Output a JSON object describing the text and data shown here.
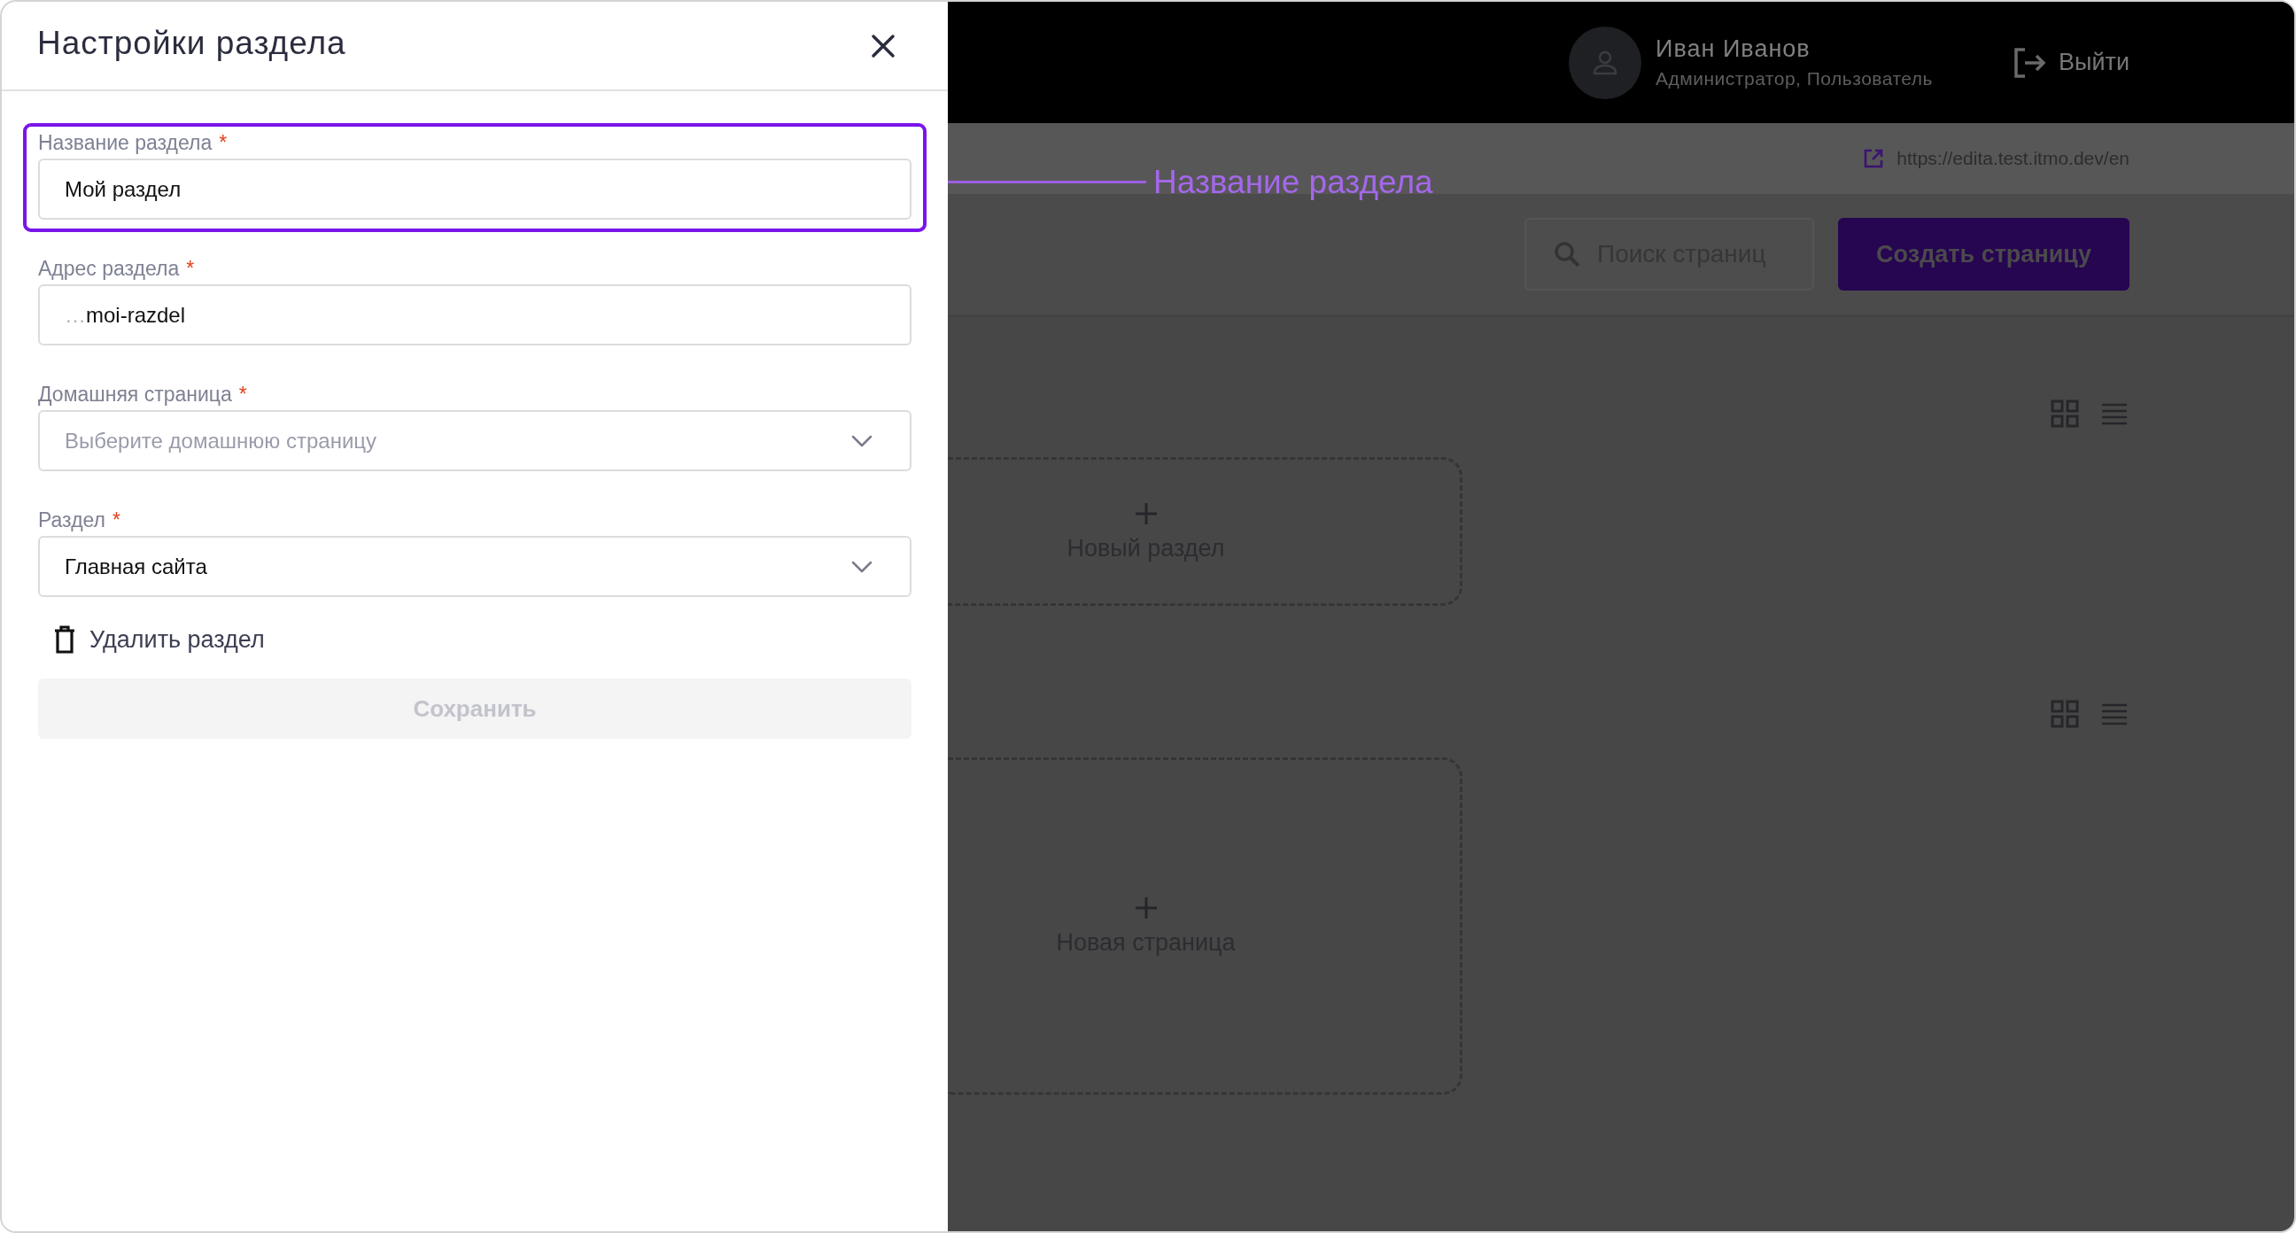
{
  "panel": {
    "title": "Настройки раздела",
    "fields": [
      {
        "kind": "text",
        "label": "Название раздела",
        "required_mark": "*",
        "highlighted": true,
        "value": "Мой раздел"
      },
      {
        "kind": "text",
        "label": "Адрес раздела",
        "required_mark": "*",
        "highlighted": false,
        "prefix": "…",
        "value": "moi-razdel"
      },
      {
        "kind": "select",
        "label": "Домашняя страница",
        "required_mark": "*",
        "highlighted": false,
        "placeholder": "Выберите домашнюю страницу"
      },
      {
        "kind": "select",
        "label": "Раздел",
        "required_mark": "*",
        "highlighted": false,
        "value": "Главная сайта"
      }
    ],
    "delete_link": "Удалить раздел",
    "save_button": {
      "label": "Сохранить",
      "disabled": true
    }
  },
  "callout": {
    "text": "Название раздела"
  },
  "app": {
    "user": {
      "name": "Иван Иванов",
      "role": "Администратор, Пользователь"
    },
    "logout": "Выйти",
    "site_url": "https://edita.test.itmo.dev/en",
    "search": {
      "placeholder": "Поиск страниц"
    },
    "create_button": "Создать страницу",
    "sections": [
      {
        "card_label": "Новый раздел"
      },
      {
        "card_label": "Новая страница"
      }
    ]
  }
}
